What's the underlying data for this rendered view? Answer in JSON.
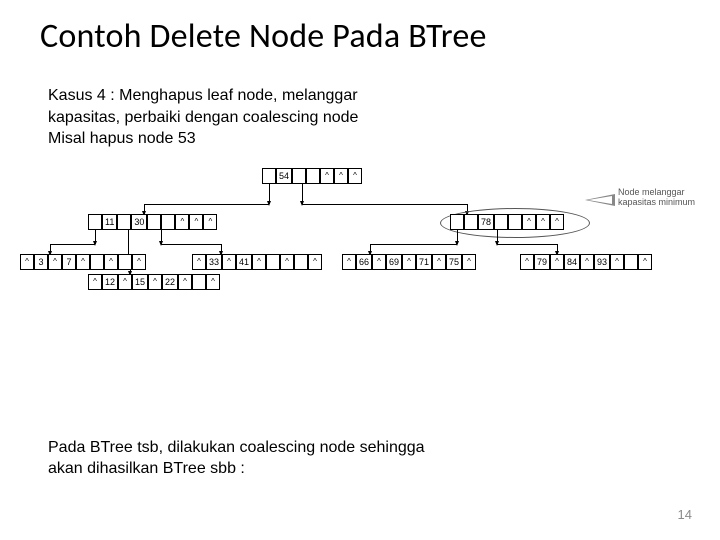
{
  "title": "Contoh Delete Node Pada BTree",
  "description_lines": [
    "Kasus 4 : Menghapus leaf node, melanggar",
    "kapasitas, perbaiki dengan coalescing node",
    "Misal hapus node 53"
  ],
  "annotation": {
    "line1": "Node melanggar",
    "line2": "kapasitas minimum"
  },
  "root": {
    "cells": [
      "",
      "54",
      "",
      "",
      "^",
      "^",
      "^"
    ]
  },
  "mid_left": {
    "cells": [
      "",
      "11",
      "",
      "30",
      "",
      "",
      "^",
      "^",
      "^"
    ]
  },
  "mid_right": {
    "cells": [
      "",
      "",
      "78",
      "",
      "",
      "^",
      "^",
      "^"
    ]
  },
  "leaf1": {
    "cells": [
      "^",
      "3",
      "^",
      "7",
      "^",
      "",
      "^",
      "",
      "^"
    ]
  },
  "leaf2": {
    "cells": [
      "^",
      "12",
      "^",
      "15",
      "^",
      "22",
      "^",
      "",
      "^"
    ]
  },
  "leaf3": {
    "cells": [
      "^",
      "33",
      "^",
      "41",
      "^",
      "",
      "^",
      "",
      "^"
    ]
  },
  "leaf4": {
    "cells": [
      "^",
      "66",
      "^",
      "69",
      "^",
      "71",
      "^",
      "75",
      "^"
    ]
  },
  "leaf5": {
    "cells": [
      "^",
      "79",
      "^",
      "84",
      "^",
      "93",
      "^",
      "",
      "^"
    ]
  },
  "footer_lines": [
    "Pada BTree tsb, dilakukan coalescing node sehingga",
    "akan dihasilkan BTree sbb :"
  ],
  "page_number": "14"
}
